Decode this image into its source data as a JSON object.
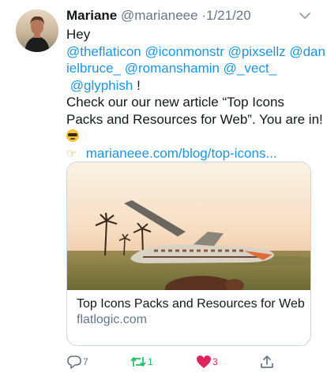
{
  "tweet": {
    "author_name": "Mariane",
    "handle": "@marianeee",
    "separator": "·",
    "date": "1/21/20",
    "body": {
      "greeting": "Hey",
      "mentions_line1": "@theflaticon @iconmonstr @pixsellz @dan",
      "mentions_line2": "ielbruce_ @romanshamin @_vect_",
      "mentions_line3": "@glyphish",
      "exclaim": " !",
      "text_line1": "Check our our new article “Top Icons",
      "text_line2": "Packs and Resources for Web”. You are in!",
      "link": "marianeee.com/blog/top-icons..."
    },
    "emoji": {
      "sunglasses": "smiling-face-with-sunglasses-emoji",
      "pointing": "backhand-index-pointing-right-emoji"
    },
    "card": {
      "title": "Top Icons Packs and Resources for Web",
      "domain": "flatlogic.com"
    },
    "actions": {
      "reply_count": "7",
      "retweet_count": "1",
      "like_count": "3"
    },
    "colors": {
      "link": "#1b95e0",
      "secondary": "#657786",
      "retweet": "#17bf63",
      "like": "#e0245e",
      "border": "#ccd6dd"
    },
    "icons": [
      "caret-down-icon",
      "reply-icon",
      "retweet-icon",
      "heart-icon",
      "share-icon"
    ]
  }
}
